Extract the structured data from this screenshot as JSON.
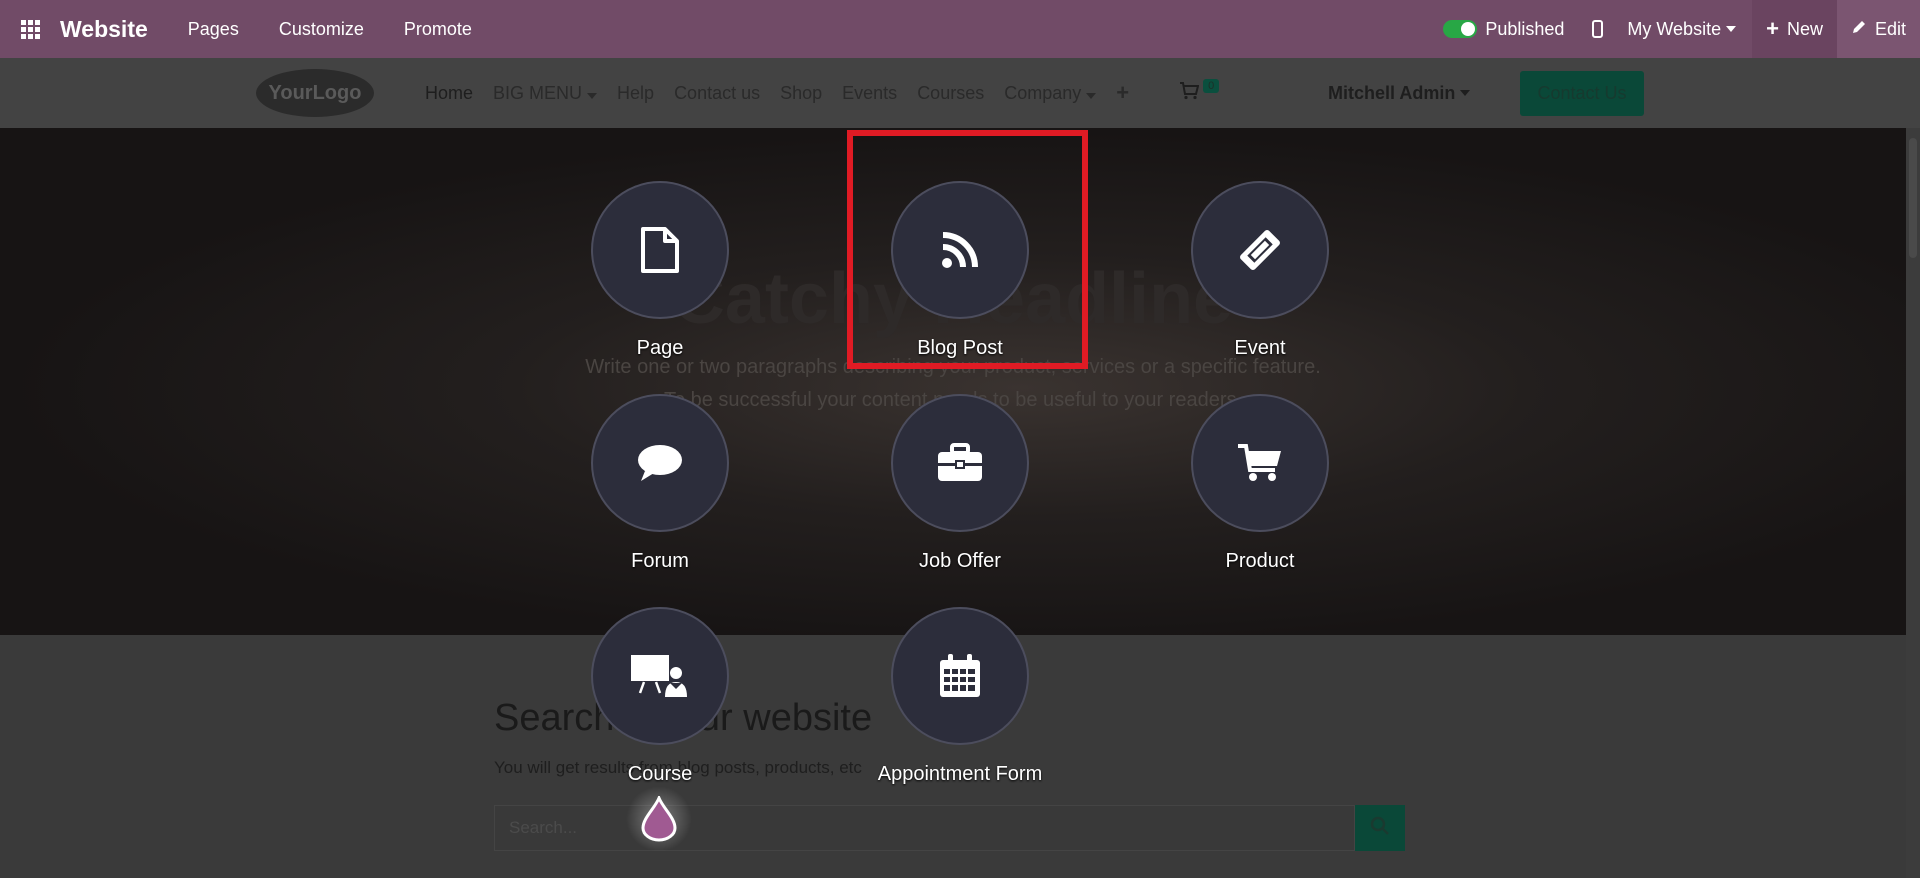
{
  "adminbar": {
    "brand": "Website",
    "menu": [
      "Pages",
      "Customize",
      "Promote"
    ],
    "published_label": "Published",
    "published": true,
    "website_selector": "My Website",
    "new_label": "New",
    "edit_label": "Edit"
  },
  "site_header": {
    "logo_text": "YourLogo",
    "nav": [
      "Home",
      "BIG MENU",
      "Help",
      "Contact us",
      "Shop",
      "Events",
      "Courses",
      "Company"
    ],
    "cart_count": "0",
    "user": "Mitchell Admin",
    "contact_button": "Contact Us"
  },
  "hero": {
    "headline": "Catchy Headline",
    "paragraph_line1": "Write one or two paragraphs describing your product, services or a specific feature.",
    "paragraph_line2": "To be successful your content needs to be useful to your readers."
  },
  "search_section": {
    "title": "Search on our website",
    "subtitle": "You will get results from blog posts, products, etc",
    "placeholder": "Search..."
  },
  "new_content_dialog": {
    "items": [
      {
        "label": "Page",
        "icon": "file-icon"
      },
      {
        "label": "Blog Post",
        "icon": "rss-icon"
      },
      {
        "label": "Event",
        "icon": "ticket-icon"
      },
      {
        "label": "Forum",
        "icon": "comment-icon"
      },
      {
        "label": "Job Offer",
        "icon": "briefcase-icon"
      },
      {
        "label": "Product",
        "icon": "shopping-cart-icon"
      },
      {
        "label": "Course",
        "icon": "presentation-icon"
      },
      {
        "label": "Appointment Form",
        "icon": "calendar-icon"
      }
    ],
    "highlighted": "Blog Post"
  },
  "colors": {
    "admin_bar": "#714b67",
    "highlight_border": "#e01b24",
    "tile_circle": "#2c2d3b",
    "published_toggle": "#28a745"
  }
}
